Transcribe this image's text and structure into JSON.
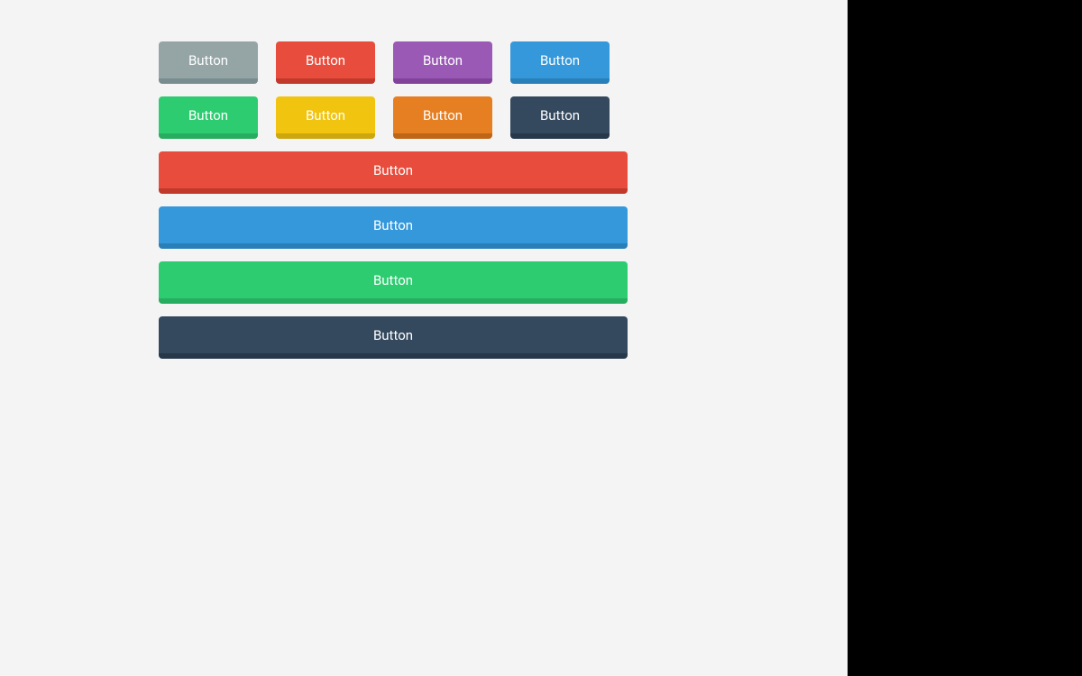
{
  "grid": {
    "buttons": [
      {
        "label": "Button",
        "name": "button-gray",
        "cls": "btn-gray"
      },
      {
        "label": "Button",
        "name": "button-red",
        "cls": "btn-red"
      },
      {
        "label": "Button",
        "name": "button-purple",
        "cls": "btn-purple"
      },
      {
        "label": "Button",
        "name": "button-blue",
        "cls": "btn-blue"
      },
      {
        "label": "Button",
        "name": "button-green",
        "cls": "btn-green"
      },
      {
        "label": "Button",
        "name": "button-yellow",
        "cls": "btn-yellow"
      },
      {
        "label": "Button",
        "name": "button-orange",
        "cls": "btn-orange"
      },
      {
        "label": "Button",
        "name": "button-dark",
        "cls": "btn-dark"
      }
    ]
  },
  "block": {
    "buttons": [
      {
        "label": "Button",
        "name": "block-button-red",
        "cls": "btn-red"
      },
      {
        "label": "Button",
        "name": "block-button-blue",
        "cls": "btn-blue"
      },
      {
        "label": "Button",
        "name": "block-button-green",
        "cls": "btn-green"
      },
      {
        "label": "Button",
        "name": "block-button-dark",
        "cls": "btn-dark"
      }
    ]
  }
}
